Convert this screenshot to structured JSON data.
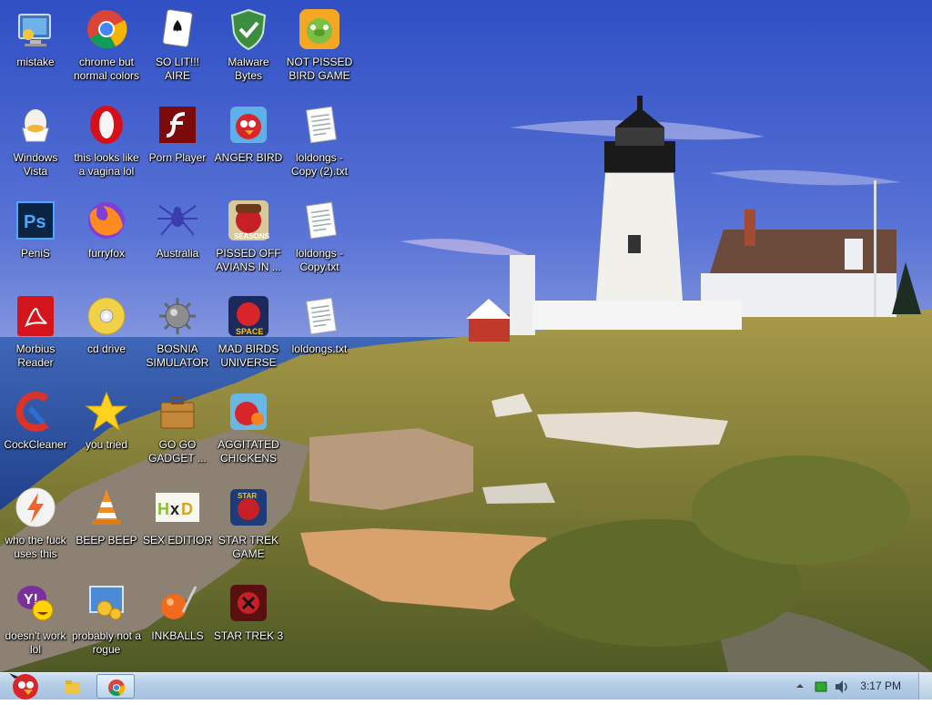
{
  "desktop": {
    "icons": [
      {
        "label": "mistake",
        "icon": "computer-icon"
      },
      {
        "label": "chrome but normal colors",
        "icon": "chrome-icon"
      },
      {
        "label": "SO LIT!!! AIRE",
        "icon": "solitaire-icon"
      },
      {
        "label": "Malware Bytes",
        "icon": "shield-icon"
      },
      {
        "label": "NOT PISSED BIRD GAME",
        "icon": "green-pig-icon"
      },
      {
        "label": "Windows Vista",
        "icon": "egg-icon"
      },
      {
        "label": "this looks like a vagina lol",
        "icon": "opera-icon"
      },
      {
        "label": "Porn Player",
        "icon": "flash-icon"
      },
      {
        "label": "ANGER BIRD",
        "icon": "red-bird-icon"
      },
      {
        "label": "loldongs - Copy (2).txt",
        "icon": "text-file-icon"
      },
      {
        "label": "PeniS",
        "icon": "photoshop-icon"
      },
      {
        "label": "furryfox",
        "icon": "firefox-icon"
      },
      {
        "label": "Australia",
        "icon": "spider-solitaire-icon"
      },
      {
        "label": "PISSED OFF AVIANS IN ...",
        "icon": "seasons-bird-icon"
      },
      {
        "label": "loldongs - Copy.txt",
        "icon": "text-file-icon"
      },
      {
        "label": "Morbius Reader",
        "icon": "pdf-reader-icon"
      },
      {
        "label": "cd drive",
        "icon": "cd-icon"
      },
      {
        "label": "BOSNIA SIMULATOR",
        "icon": "mine-icon"
      },
      {
        "label": "MAD BIRDS UNIVERSE",
        "icon": "space-bird-icon"
      },
      {
        "label": "loldongs.txt",
        "icon": "text-file-icon"
      },
      {
        "label": "CockCleaner",
        "icon": "ccleaner-icon"
      },
      {
        "label": "you tried",
        "icon": "star-icon"
      },
      {
        "label": "GO GO GADGET ...",
        "icon": "toolbox-icon"
      },
      {
        "label": "AGGITATED CHICKENS I...",
        "icon": "bird-orange-icon"
      },
      {
        "label": "who the fuck uses this",
        "icon": "lightning-icon"
      },
      {
        "label": "BEEP BEEP",
        "icon": "vlc-cone-icon"
      },
      {
        "label": "SEX EDITIOR",
        "icon": "hxd-icon"
      },
      {
        "label": "STAR TREK GAME",
        "icon": "star-wars-bird-icon"
      },
      {
        "label": "doesn't work lol",
        "icon": "yahoo-icon"
      },
      {
        "label": "probably not a rogue",
        "icon": "gear-window-icon"
      },
      {
        "label": "INKBALLS",
        "icon": "inkball-icon"
      },
      {
        "label": "STAR TREK 3",
        "icon": "star-wars-bird-dark-icon"
      }
    ]
  },
  "taskbar": {
    "start_icon": "angry-bird-start-icon",
    "pinned": [
      {
        "name": "explorer",
        "icon": "folder-icon"
      },
      {
        "name": "chrome",
        "icon": "chrome-icon",
        "active": true
      }
    ],
    "tray": {
      "clock": "3:17 PM",
      "icons": [
        "show-hidden-icon",
        "network-icon",
        "volume-icon"
      ]
    }
  },
  "colors": {
    "sky_top": "#3d5fd0",
    "sky_bottom": "#a9b6e6",
    "taskbar": "#b4cde6",
    "label_text": "#ffffff"
  }
}
